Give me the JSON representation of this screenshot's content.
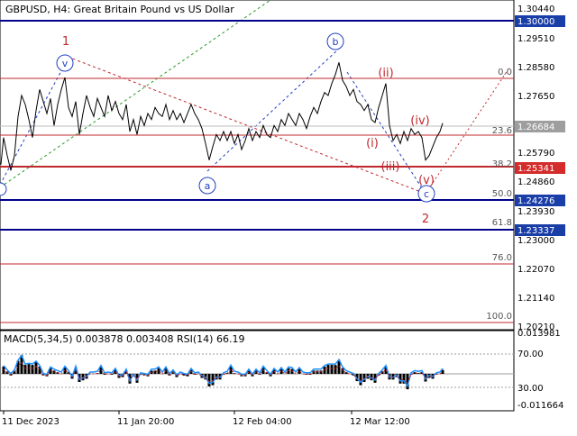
{
  "header": {
    "title": "GBPUSD, H4:  Great Britain Pound vs US Dollar"
  },
  "price_axis": {
    "labels": [
      "1.30440",
      "1.29510",
      "1.28580",
      "1.27650",
      "1.25790",
      "1.24860",
      "1.23930",
      "1.23000",
      "1.22070",
      "1.21140",
      "1.20210"
    ]
  },
  "price_tags": {
    "resistance": "1.30000",
    "current": "1.26684",
    "support_red": "1.25341",
    "support_blue": "1.24276",
    "support_low": "1.23337"
  },
  "fibonacci": {
    "levels": [
      "0.0",
      "23.6",
      "38.2",
      "50.0",
      "61.8",
      "76.0",
      "100.0"
    ]
  },
  "wave_labels": {
    "w1": "1",
    "w2": "2",
    "wv_left": "v",
    "wa": "a",
    "wb": "b",
    "wc": "c",
    "wi": "(i)",
    "wii": "(ii)",
    "wiii": "(iii)",
    "wiv": "(iv)",
    "wv": "(v)"
  },
  "indicator": {
    "caption": "MACD(5,34,5) 0.003878 0.003408 RSI(14) 66.19",
    "axis_labels": [
      "0.013981",
      "70.00",
      "30.00",
      "-0.011664"
    ]
  },
  "time_axis": {
    "labels": [
      "11 Dec 2023",
      "11 Jan 20:00",
      "12 Feb 04:00",
      "12 Mar 12:00"
    ]
  },
  "colors": {
    "price_line": "#000000",
    "resistance": "#00008b",
    "red_level": "#c0282d",
    "tag_blue": "#1a3ea8",
    "tag_grey": "#9e9e9e",
    "tag_red": "#d42b2b",
    "wave_blue": "#1f3fbf",
    "rsi_blue": "#1e90ff"
  },
  "chart_data": {
    "type": "line",
    "title": "GBPUSD, H4:  Great Britain Pound vs US Dollar",
    "x_labels": [
      "11 Dec 2023",
      "11 Jan 20:00",
      "12 Feb 04:00",
      "12 Mar 12:00"
    ],
    "ylim": [
      1.198,
      1.3078
    ],
    "price_path": [
      [
        1,
        1.253
      ],
      [
        4,
        1.262
      ],
      [
        8,
        1.256
      ],
      [
        12,
        1.251
      ],
      [
        16,
        1.256
      ],
      [
        20,
        1.269
      ],
      [
        24,
        1.276
      ],
      [
        28,
        1.273
      ],
      [
        32,
        1.268
      ],
      [
        36,
        1.262
      ],
      [
        40,
        1.271
      ],
      [
        44,
        1.278
      ],
      [
        48,
        1.274
      ],
      [
        52,
        1.27
      ],
      [
        56,
        1.275
      ],
      [
        60,
        1.266
      ],
      [
        64,
        1.273
      ],
      [
        68,
        1.278
      ],
      [
        72,
        1.282
      ],
      [
        76,
        1.272
      ],
      [
        80,
        1.269
      ],
      [
        84,
        1.274
      ],
      [
        88,
        1.263
      ],
      [
        92,
        1.27
      ],
      [
        96,
        1.276
      ],
      [
        100,
        1.272
      ],
      [
        104,
        1.269
      ],
      [
        108,
        1.275
      ],
      [
        112,
        1.272
      ],
      [
        116,
        1.269
      ],
      [
        120,
        1.276
      ],
      [
        124,
        1.271
      ],
      [
        128,
        1.274
      ],
      [
        132,
        1.27
      ],
      [
        136,
        1.268
      ],
      [
        140,
        1.273
      ],
      [
        144,
        1.264
      ],
      [
        148,
        1.268
      ],
      [
        152,
        1.263
      ],
      [
        156,
        1.269
      ],
      [
        160,
        1.266
      ],
      [
        164,
        1.27
      ],
      [
        168,
        1.268
      ],
      [
        172,
        1.272
      ],
      [
        176,
        1.27
      ],
      [
        180,
        1.269
      ],
      [
        184,
        1.273
      ],
      [
        188,
        1.268
      ],
      [
        192,
        1.271
      ],
      [
        196,
        1.268
      ],
      [
        200,
        1.27
      ],
      [
        204,
        1.267
      ],
      [
        208,
        1.27
      ],
      [
        212,
        1.273
      ],
      [
        216,
        1.27
      ],
      [
        220,
        1.268
      ],
      [
        224,
        1.265
      ],
      [
        228,
        1.26
      ],
      [
        232,
        1.2545
      ],
      [
        236,
        1.259
      ],
      [
        240,
        1.263
      ],
      [
        244,
        1.261
      ],
      [
        248,
        1.264
      ],
      [
        252,
        1.261
      ],
      [
        256,
        1.264
      ],
      [
        260,
        1.26
      ],
      [
        264,
        1.263
      ],
      [
        268,
        1.258
      ],
      [
        272,
        1.261
      ],
      [
        276,
        1.265
      ],
      [
        280,
        1.261
      ],
      [
        284,
        1.264
      ],
      [
        288,
        1.262
      ],
      [
        292,
        1.266
      ],
      [
        296,
        1.263
      ],
      [
        300,
        1.262
      ],
      [
        304,
        1.266
      ],
      [
        308,
        1.264
      ],
      [
        312,
        1.268
      ],
      [
        316,
        1.266
      ],
      [
        320,
        1.27
      ],
      [
        324,
        1.268
      ],
      [
        328,
        1.266
      ],
      [
        332,
        1.27
      ],
      [
        336,
        1.268
      ],
      [
        340,
        1.265
      ],
      [
        344,
        1.269
      ],
      [
        348,
        1.272
      ],
      [
        352,
        1.27
      ],
      [
        356,
        1.274
      ],
      [
        360,
        1.277
      ],
      [
        364,
        1.276
      ],
      [
        368,
        1.28
      ],
      [
        372,
        1.283
      ],
      [
        376,
        1.287
      ],
      [
        380,
        1.281
      ],
      [
        384,
        1.279
      ],
      [
        388,
        1.276
      ],
      [
        392,
        1.278
      ],
      [
        396,
        1.274
      ],
      [
        400,
        1.273
      ],
      [
        404,
        1.271
      ],
      [
        408,
        1.273
      ],
      [
        412,
        1.268
      ],
      [
        416,
        1.267
      ],
      [
        420,
        1.272
      ],
      [
        424,
        1.276
      ],
      [
        428,
        1.28
      ],
      [
        432,
        1.266
      ],
      [
        436,
        1.261
      ],
      [
        440,
        1.263
      ],
      [
        444,
        1.26
      ],
      [
        448,
        1.264
      ],
      [
        452,
        1.261
      ],
      [
        456,
        1.265
      ],
      [
        460,
        1.263
      ],
      [
        464,
        1.264
      ],
      [
        468,
        1.262
      ],
      [
        472,
        1.2545
      ],
      [
        476,
        1.256
      ],
      [
        480,
        1.259
      ],
      [
        484,
        1.262
      ],
      [
        488,
        1.264
      ],
      [
        491,
        1.2668
      ]
    ]
  }
}
